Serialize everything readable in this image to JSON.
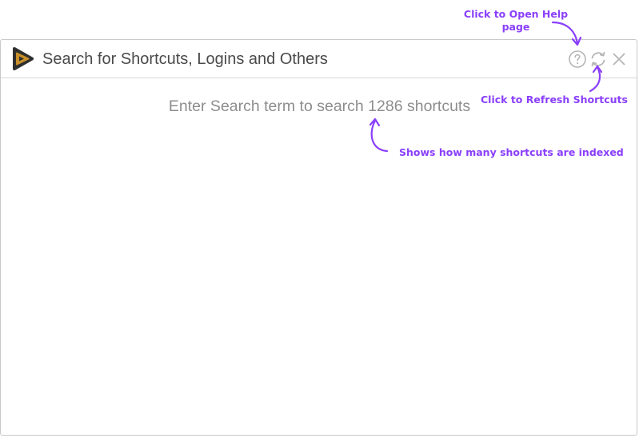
{
  "search": {
    "placeholder": "Search for Shortcuts, Logins and Others",
    "value": "",
    "hint": "Enter Search term to search 1286 shortcuts"
  },
  "toolbar": {
    "help_icon": "help-circle-icon",
    "refresh_icon": "refresh-icon",
    "close_icon": "close-icon"
  },
  "annotations": {
    "help": "Click to Open Help page",
    "refresh": "Click to Refresh Shortcuts",
    "count": "Shows how many shortcuts are indexed"
  },
  "colors": {
    "annotation": "#8a3ffc",
    "logo_outer": "#2f2f2f",
    "logo_inner": "#c8902a",
    "icon_gray": "#b5b5b5"
  }
}
